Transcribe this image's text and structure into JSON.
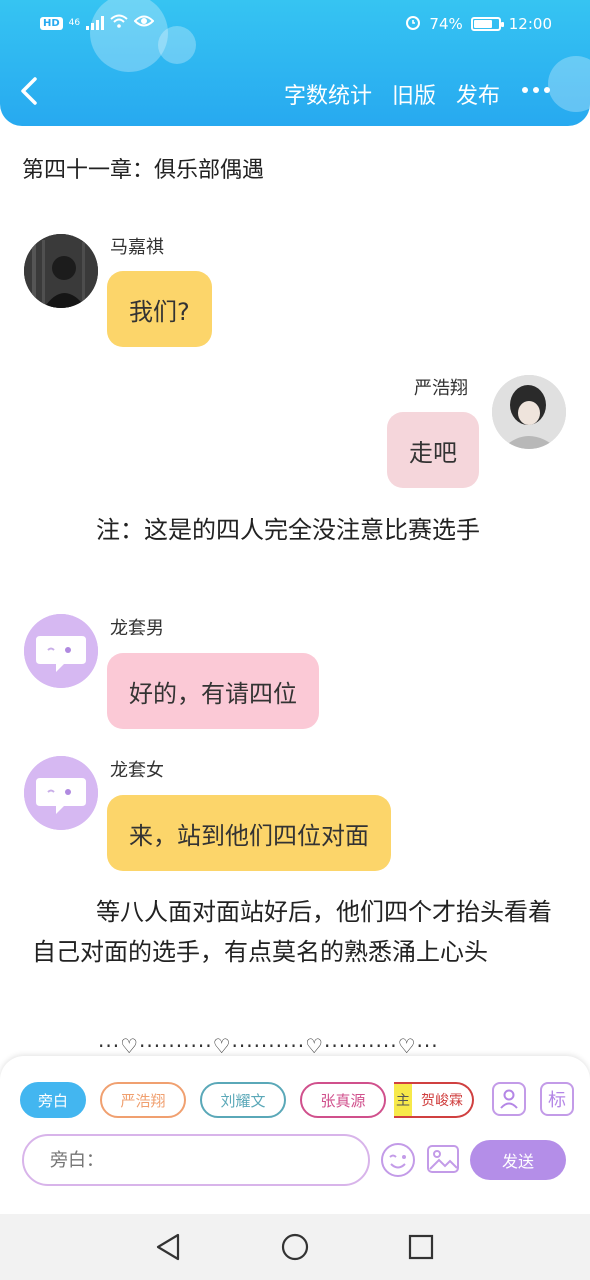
{
  "status_bar": {
    "left_badges": [
      "HD",
      "46"
    ],
    "battery": "74%",
    "time": "12:00",
    "battery_level": 0.74
  },
  "header": {
    "actions": [
      "字数统计",
      "旧版",
      "发布"
    ]
  },
  "chapter_title": "第四十一章：俱乐部偶遇",
  "messages": [
    {
      "name": "马嘉祺",
      "text": "我们?",
      "side": "left",
      "color": "#fcd56a"
    },
    {
      "name": "严浩翔",
      "text": "走吧",
      "side": "right",
      "color": "#f5d6db"
    },
    {
      "name": "龙套男",
      "text": "好的，有请四位",
      "side": "left",
      "color": "#fbc9d6"
    },
    {
      "name": "龙套女",
      "text": "来，站到他们四位对面",
      "side": "left",
      "color": "#fcd56a"
    }
  ],
  "narrations": [
    "注：这是的四人完全没注意比赛选手",
    "等八人面对面站好后，他们四个才抬头看着自己对面的选手，有点莫名的熟悉涌上心头"
  ],
  "divider": "···♡··········♡··········♡··········♡···",
  "panel": {
    "role_chips": [
      {
        "label": "旁白",
        "color": "#43b6f0",
        "selected": true
      },
      {
        "label": "严浩翔",
        "color": "#f0a070",
        "selected": false
      },
      {
        "label": "刘耀文",
        "color": "#5aa8b8",
        "selected": false
      },
      {
        "label": "张真源",
        "color": "#d0508c",
        "selected": false
      },
      {
        "label": "贺峻霖",
        "color": "#d04040",
        "selected": false
      }
    ],
    "main_tag": "主",
    "tag_button": "标",
    "input_placeholder": "旁白：",
    "send_label": "发送"
  }
}
